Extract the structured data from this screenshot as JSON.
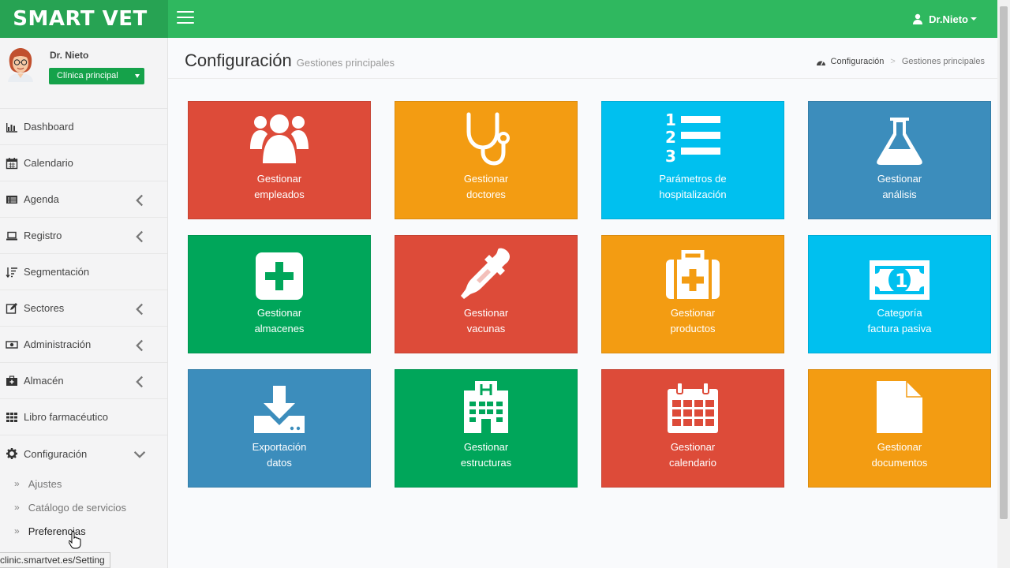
{
  "app": {
    "logo": "SMART VET"
  },
  "topbar": {
    "user": "Dr.Nieto"
  },
  "sidebar": {
    "user_name": "Dr. Nieto",
    "clinic": "Clínica principal",
    "items": [
      {
        "label": "Dashboard"
      },
      {
        "label": "Calendario"
      },
      {
        "label": "Agenda"
      },
      {
        "label": "Registro"
      },
      {
        "label": "Segmentación"
      },
      {
        "label": "Sectores"
      },
      {
        "label": "Administración"
      },
      {
        "label": "Almacén"
      },
      {
        "label": "Libro farmacéutico"
      },
      {
        "label": "Configuración"
      }
    ],
    "subitems": [
      {
        "label": "Ajustes"
      },
      {
        "label": "Catálogo de servicios"
      },
      {
        "label": "Preferencias"
      }
    ]
  },
  "header": {
    "title": "Configuración",
    "subtitle": "Gestiones principales",
    "breadcrumb": [
      "Configuración",
      "Gestiones principales"
    ]
  },
  "tiles": [
    {
      "line1": "Gestionar",
      "line2": "empleados",
      "color": "#dd4b39",
      "icon": "users-icon"
    },
    {
      "line1": "Gestionar",
      "line2": "doctores",
      "color": "#f39c12",
      "icon": "stethoscope-icon"
    },
    {
      "line1": "Parámetros de",
      "line2": "hospitalización",
      "color": "#00c0ef",
      "icon": "numbered-list-icon"
    },
    {
      "line1": "Gestionar",
      "line2": "análisis",
      "color": "#3c8dbc",
      "icon": "flask-icon"
    },
    {
      "line1": "Gestionar",
      "line2": "almacenes",
      "color": "#00a65a",
      "icon": "plus-square-icon"
    },
    {
      "line1": "Gestionar",
      "line2": "vacunas",
      "color": "#dd4b39",
      "icon": "eyedropper-icon"
    },
    {
      "line1": "Gestionar",
      "line2": "productos",
      "color": "#f39c12",
      "icon": "medkit-icon"
    },
    {
      "line1": "Categoría",
      "line2": "factura pasiva",
      "color": "#00c0ef",
      "icon": "banknote-icon"
    },
    {
      "line1": "Exportación",
      "line2": "datos",
      "color": "#3c8dbc",
      "icon": "download-icon"
    },
    {
      "line1": "Gestionar",
      "line2": "estructuras",
      "color": "#00a65a",
      "icon": "hospital-icon"
    },
    {
      "line1": "Gestionar",
      "line2": "calendario",
      "color": "#dd4b39",
      "icon": "calendar-icon"
    },
    {
      "line1": "Gestionar",
      "line2": "documentos",
      "color": "#f39c12",
      "icon": "file-icon"
    }
  ],
  "status_bar": {
    "url": "clinic.smartvet.es/Setting"
  }
}
